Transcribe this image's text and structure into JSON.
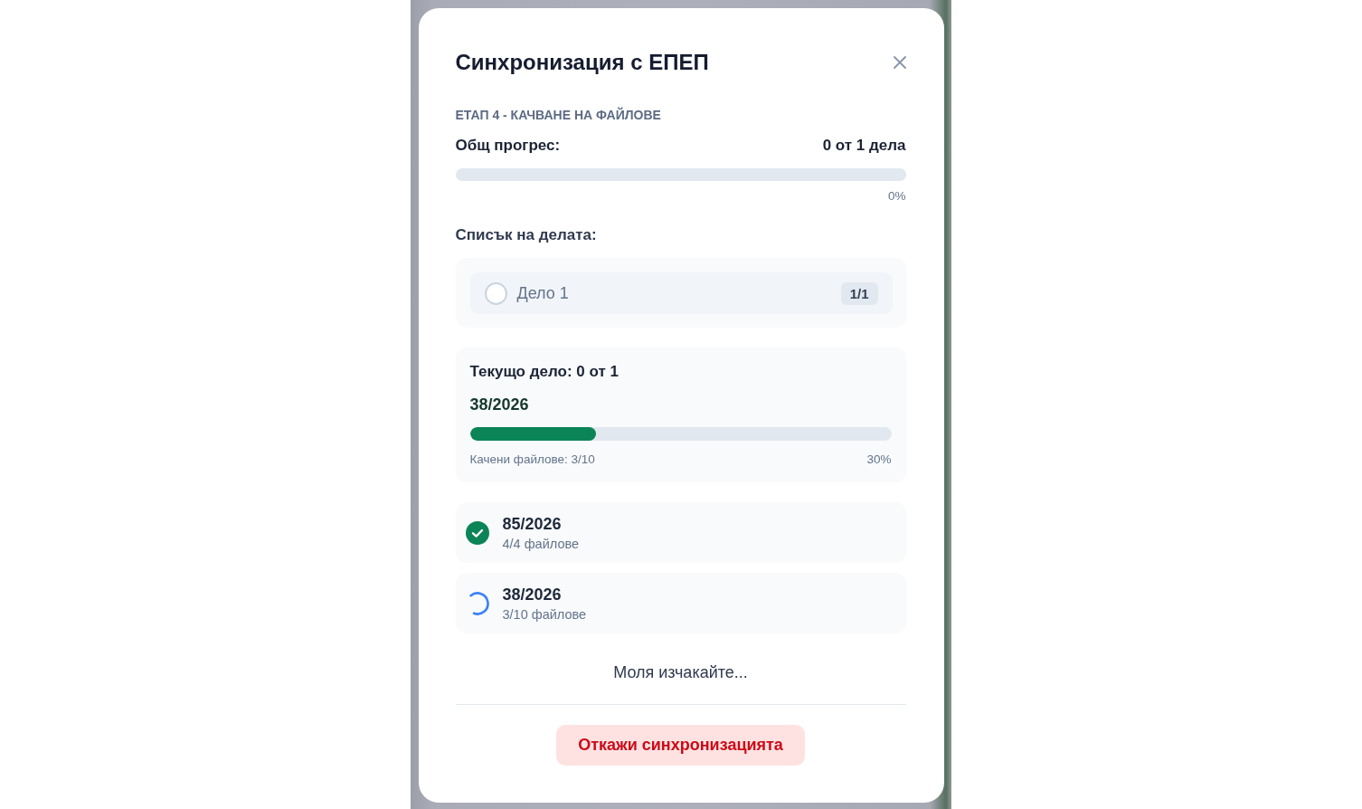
{
  "dialog": {
    "title": "Синхронизация с ЕПЕП",
    "stage": "ЕТАП 4 - КАЧВАНЕ НА ФАЙЛОВЕ",
    "overall_progress": {
      "label": "Общ прогрес:",
      "count": "0 от 1 дела",
      "percent": "0%"
    },
    "case_list": {
      "title": "Списък на делата:",
      "items": [
        {
          "name": "Дело 1",
          "badge": "1/1",
          "done": false
        }
      ]
    },
    "current_case": {
      "title": "Текущо дело: 0 от 1",
      "number": "38/2026",
      "level": 0.3,
      "files_label": "Качени файлове: 3/10",
      "percent": "30%"
    },
    "files": [
      {
        "number": "85/2026",
        "count": "4/4 файлове",
        "done": true
      },
      {
        "number": "38/2026",
        "count": "3/10 файлове",
        "done": false
      }
    ],
    "wait_message": "Моля изчакайте...",
    "cancel_button": "Откажи синхронизацията"
  }
}
